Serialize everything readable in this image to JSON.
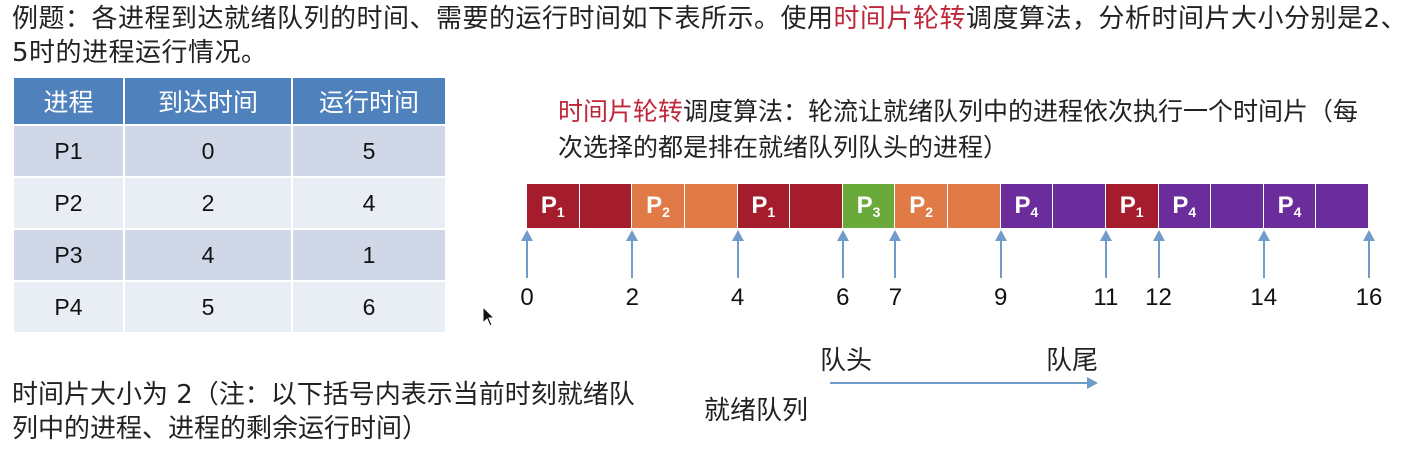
{
  "title": {
    "prefix": "例题：各进程到达就绪队列的时间、需要的运行时间如下表所示。使用",
    "highlight": "时间片轮转",
    "suffix": "调度算法，分析时间片大小分别是2、5时的进程运行情况。"
  },
  "table": {
    "headers": [
      "进程",
      "到达时间",
      "运行时间"
    ],
    "rows": [
      [
        "P1",
        "0",
        "5"
      ],
      [
        "P2",
        "2",
        "4"
      ],
      [
        "P3",
        "4",
        "1"
      ],
      [
        "P4",
        "5",
        "6"
      ]
    ]
  },
  "rr_description": {
    "highlight": "时间片轮转",
    "text": "调度算法：轮流让就绪队列中的进程依次执行一个时间片（每次选择的都是排在就绪队列队头的进程）"
  },
  "gantt": {
    "start": 0,
    "end": 16,
    "colors": {
      "P1": "#a51d2d",
      "P2": "#e07b47",
      "P3": "#6aaa3a",
      "P4": "#6c2d9c"
    },
    "segments": [
      {
        "process": "P1",
        "start": 0,
        "end": 1,
        "label": "P1"
      },
      {
        "process": "P1",
        "start": 1,
        "end": 2,
        "label": ""
      },
      {
        "process": "P2",
        "start": 2,
        "end": 3,
        "label": "P2"
      },
      {
        "process": "P2",
        "start": 3,
        "end": 4,
        "label": ""
      },
      {
        "process": "P1",
        "start": 4,
        "end": 5,
        "label": "P1"
      },
      {
        "process": "P1",
        "start": 5,
        "end": 6,
        "label": ""
      },
      {
        "process": "P3",
        "start": 6,
        "end": 7,
        "label": "P3"
      },
      {
        "process": "P2",
        "start": 7,
        "end": 8,
        "label": "P2"
      },
      {
        "process": "P2",
        "start": 8,
        "end": 9,
        "label": ""
      },
      {
        "process": "P4",
        "start": 9,
        "end": 10,
        "label": "P4"
      },
      {
        "process": "P4",
        "start": 10,
        "end": 11,
        "label": ""
      },
      {
        "process": "P1",
        "start": 11,
        "end": 12,
        "label": "P1"
      },
      {
        "process": "P4",
        "start": 12,
        "end": 13,
        "label": "P4"
      },
      {
        "process": "P4",
        "start": 13,
        "end": 14,
        "label": ""
      },
      {
        "process": "P4",
        "start": 14,
        "end": 15,
        "label": "P4"
      },
      {
        "process": "P4",
        "start": 15,
        "end": 16,
        "label": ""
      }
    ],
    "ticks": [
      "0",
      "2",
      "4",
      "6",
      "7",
      "9",
      "11",
      "12",
      "14",
      "16"
    ],
    "tick_values": [
      0,
      2,
      4,
      6,
      7,
      9,
      11,
      12,
      14,
      16
    ]
  },
  "queue": {
    "head": "队头",
    "tail": "队尾",
    "label": "就绪队列"
  },
  "note": "时间片大小为 2（注：以下括号内表示当前时刻就绪队列中的进程、进程的剩余运行时间）"
}
